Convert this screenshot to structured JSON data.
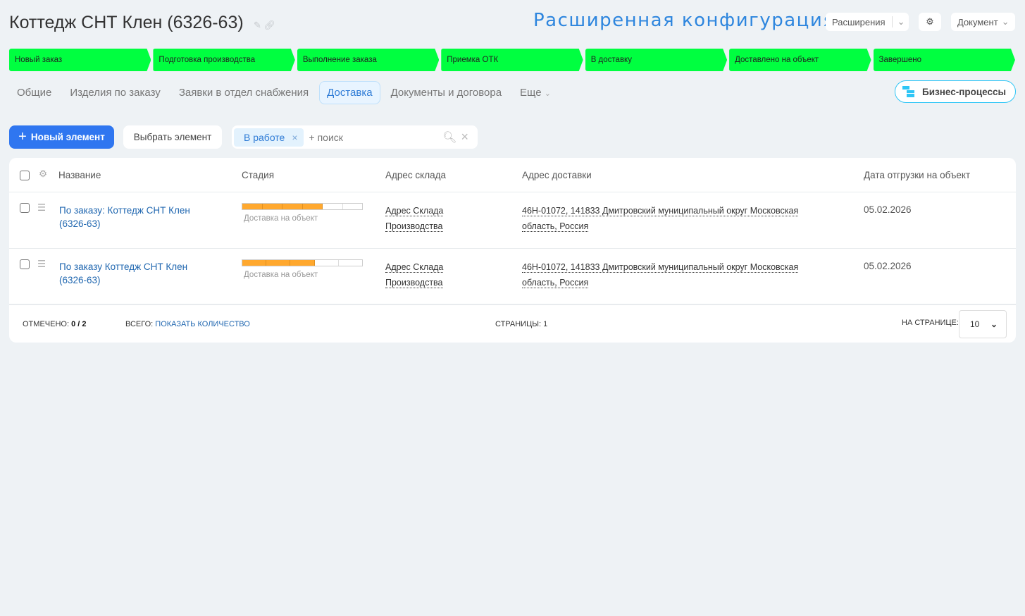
{
  "header": {
    "title": "Коттедж СНТ Клен (6326-63)",
    "config_title": "Расширенная конфигурация",
    "extensions_label": "Расширения",
    "document_label": "Документ"
  },
  "stages": [
    "Новый заказ",
    "Подготовка производства",
    "Выполнение заказа",
    "Приемка ОТК",
    "В доставку",
    "Доставлено на объект",
    "Завершено"
  ],
  "stage_color": "#00ff40",
  "tabs": [
    "Общие",
    "Изделия по заказу",
    "Заявки в отдел снабжения",
    "Доставка",
    "Документы и договора",
    "Еще"
  ],
  "active_tab": "Доставка",
  "business_processes_label": "Бизнес-процессы",
  "toolbar": {
    "new_label": "Новый элемент",
    "select_label": "Выбрать элемент",
    "filter_chip": "В работе",
    "search_placeholder": "+ поиск"
  },
  "table": {
    "headers": [
      "Название",
      "Стадия",
      "Адрес склада",
      "Адрес доставки",
      "Дата отгрузки на объект"
    ],
    "rows": [
      {
        "name_line1": "По заказу: Коттедж СНТ Клен",
        "name_line2": "(6326-63)",
        "stage": "Доставка на объект",
        "progress_filled": 4,
        "progress_total": 6,
        "warehouse_line1": "Адрес Склада",
        "warehouse_line2": "Производства",
        "delivery_line1": "46Н-01072, 141833 Дмитровский муниципальный округ Московская",
        "delivery_line2": "область, Россия",
        "date": "05.02.2026"
      },
      {
        "name_line1": "По заказу Коттедж СНТ Клен",
        "name_line2": "(6326-63)",
        "stage": "Доставка на объект",
        "progress_filled": 3,
        "progress_total": 5,
        "warehouse_line1": "Адрес Склада",
        "warehouse_line2": "Производства",
        "delivery_line1": "46Н-01072, 141833 Дмитровский муниципальный округ Московская",
        "delivery_line2": "область, Россия",
        "date": "05.02.2026"
      }
    ]
  },
  "footer": {
    "marked_label": "ОТМЕЧЕНО:",
    "marked_value": "0 / 2",
    "total_label": "ВСЕГО:",
    "total_link": "ПОКАЗАТЬ КОЛИЧЕСТВО",
    "pages_label": "СТРАНИЦЫ:",
    "pages_value": "1",
    "per_page_label": "НА СТРАНИЦЕ:",
    "per_page_value": "10"
  }
}
